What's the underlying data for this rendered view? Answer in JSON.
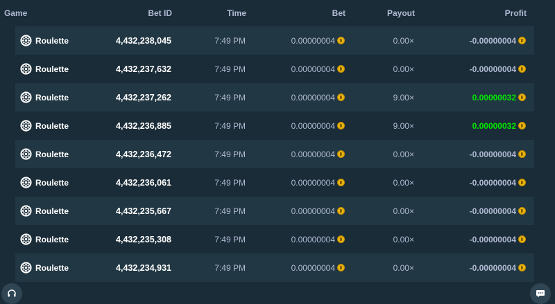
{
  "table": {
    "headers": {
      "game": "Game",
      "bet_id": "Bet ID",
      "time": "Time",
      "bet": "Bet",
      "payout": "Payout",
      "profit": "Profit"
    },
    "rows": [
      {
        "game": "Roulette",
        "bet_id": "4,432,238,045",
        "time": "7:49 PM",
        "bet": "0.00000004",
        "payout": "0.00×",
        "profit": "-0.00000004",
        "win": false
      },
      {
        "game": "Roulette",
        "bet_id": "4,432,237,632",
        "time": "7:49 PM",
        "bet": "0.00000004",
        "payout": "0.00×",
        "profit": "-0.00000004",
        "win": false
      },
      {
        "game": "Roulette",
        "bet_id": "4,432,237,262",
        "time": "7:49 PM",
        "bet": "0.00000004",
        "payout": "9.00×",
        "profit": "0.00000032",
        "win": true
      },
      {
        "game": "Roulette",
        "bet_id": "4,432,236,885",
        "time": "7:49 PM",
        "bet": "0.00000004",
        "payout": "9.00×",
        "profit": "0.00000032",
        "win": true
      },
      {
        "game": "Roulette",
        "bet_id": "4,432,236,472",
        "time": "7:49 PM",
        "bet": "0.00000004",
        "payout": "0.00×",
        "profit": "-0.00000004",
        "win": false
      },
      {
        "game": "Roulette",
        "bet_id": "4,432,236,061",
        "time": "7:49 PM",
        "bet": "0.00000004",
        "payout": "0.00×",
        "profit": "-0.00000004",
        "win": false
      },
      {
        "game": "Roulette",
        "bet_id": "4,432,235,667",
        "time": "7:49 PM",
        "bet": "0.00000004",
        "payout": "0.00×",
        "profit": "-0.00000004",
        "win": false
      },
      {
        "game": "Roulette",
        "bet_id": "4,432,235,308",
        "time": "7:49 PM",
        "bet": "0.00000004",
        "payout": "0.00×",
        "profit": "-0.00000004",
        "win": false
      },
      {
        "game": "Roulette",
        "bet_id": "4,432,234,931",
        "time": "7:49 PM",
        "bet": "0.00000004",
        "payout": "0.00×",
        "profit": "-0.00000004",
        "win": false
      }
    ]
  },
  "icons": {
    "game": "roulette-icon",
    "currency": "coin-icon",
    "support": "headset-icon",
    "chat": "chat-icon"
  },
  "colors": {
    "background": "#1a2c38",
    "row_alt": "#213743",
    "text_muted": "#b1bad3",
    "text_strong": "#ffffff",
    "win": "#00e701",
    "coin": "#e8b20d"
  }
}
